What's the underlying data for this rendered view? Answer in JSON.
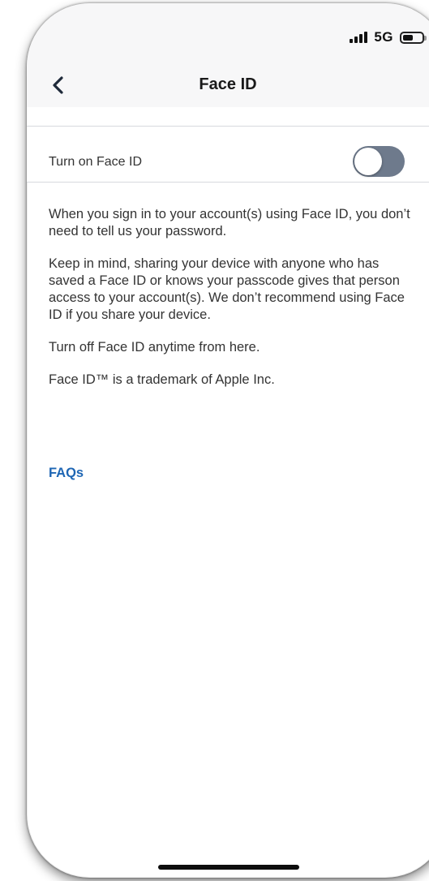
{
  "status_bar": {
    "network": "5G",
    "icons": [
      "signal-icon",
      "battery-icon"
    ],
    "battery_level": 0.55
  },
  "nav": {
    "title": "Face ID",
    "back_icon": "chevron-left-icon"
  },
  "settings": {
    "toggle_label": "Turn on Face ID",
    "toggle_on": false,
    "toggle_color": "#6e7a8c"
  },
  "content": {
    "paragraph_1": "When you sign in to your account(s) using Face ID, you don’t need to tell us your password.",
    "paragraph_2": "Keep in mind, sharing your device with anyone who has saved a Face ID or knows your passcode gives that person access to your account(s).  We don’t recommend using Face ID if you share your device.",
    "paragraph_3": "Turn off Face ID anytime from here.",
    "paragraph_4": "Face ID™ is a trademark of Apple Inc."
  },
  "links": {
    "faqs": "FAQs",
    "link_color": "#1e66b4"
  }
}
